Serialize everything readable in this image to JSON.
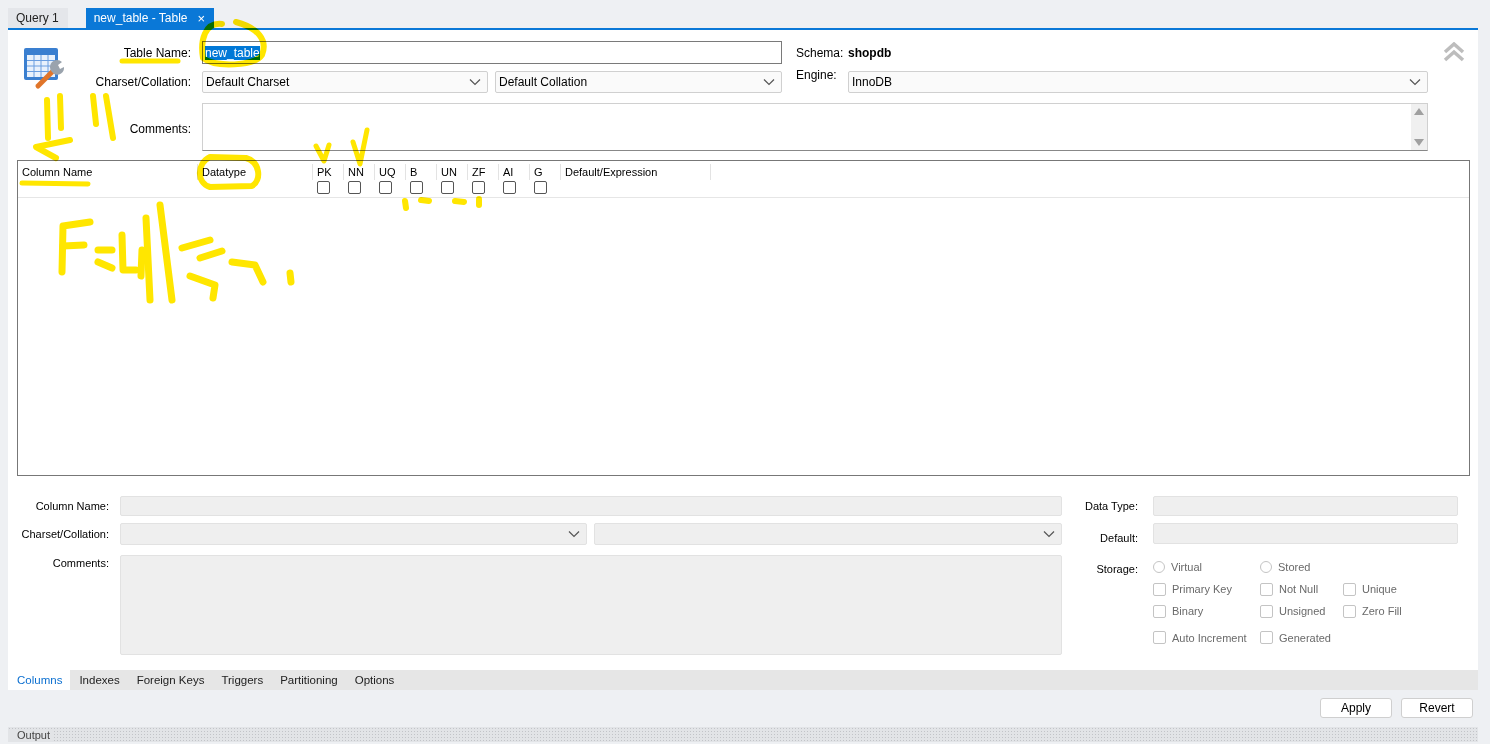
{
  "editor_tabs": [
    {
      "label": "Query 1",
      "selected": false,
      "closable": false
    },
    {
      "label": "new_table - Table",
      "selected": true,
      "closable": true,
      "close_glyph": "×"
    }
  ],
  "table": {
    "name_label": "Table Name:",
    "name": "new_table",
    "name_text_selected": true,
    "schema_label": "Schema:",
    "schema": "shopdb",
    "charset_label": "Charset/Collation:",
    "charset": "Default Charset",
    "collation": "Default Collation",
    "engine_label": "Engine:",
    "engine": "InnoDB",
    "comments_label": "Comments:"
  },
  "columns_grid": {
    "headers": [
      {
        "label": "Column Name",
        "kind": "text"
      },
      {
        "label": "Datatype",
        "kind": "text"
      },
      {
        "label": "PK",
        "kind": "flag",
        "checked": false
      },
      {
        "label": "NN",
        "kind": "flag",
        "checked": false
      },
      {
        "label": "UQ",
        "kind": "flag",
        "checked": false
      },
      {
        "label": "B",
        "kind": "flag",
        "checked": false
      },
      {
        "label": "UN",
        "kind": "flag",
        "checked": false
      },
      {
        "label": "ZF",
        "kind": "flag",
        "checked": false
      },
      {
        "label": "AI",
        "kind": "flag",
        "checked": false
      },
      {
        "label": "G",
        "kind": "flag",
        "checked": false
      },
      {
        "label": "Default/Expression",
        "kind": "text"
      }
    ]
  },
  "column_details": {
    "disabled": true,
    "column_name_label": "Column Name:",
    "charset_label": "Charset/Collation:",
    "comments_label": "Comments:",
    "data_type_label": "Data Type:",
    "default_label": "Default:",
    "storage_label": "Storage:",
    "storage_options": [
      {
        "label": "Virtual",
        "selected": false
      },
      {
        "label": "Stored",
        "selected": false
      }
    ],
    "flag_rows": [
      {
        "flags": [
          {
            "label": "Primary Key",
            "checked": false
          },
          {
            "label": "Not Null",
            "checked": false
          },
          {
            "label": "Unique",
            "checked": false
          }
        ]
      },
      {
        "flags": [
          {
            "label": "Binary",
            "checked": false
          },
          {
            "label": "Unsigned",
            "checked": false
          },
          {
            "label": "Zero Fill",
            "checked": false
          }
        ]
      },
      {
        "flags": [
          {
            "label": "Auto Increment",
            "checked": false
          },
          {
            "label": "Generated",
            "checked": false
          }
        ]
      }
    ]
  },
  "editor_sections": [
    {
      "label": "Columns",
      "selected": true
    },
    {
      "label": "Indexes",
      "selected": false
    },
    {
      "label": "Foreign Keys",
      "selected": false
    },
    {
      "label": "Triggers",
      "selected": false
    },
    {
      "label": "Partitioning",
      "selected": false
    },
    {
      "label": "Options",
      "selected": false
    }
  ],
  "buttons": [
    "Apply",
    "Revert"
  ],
  "output_panel": {
    "title": "Output"
  }
}
